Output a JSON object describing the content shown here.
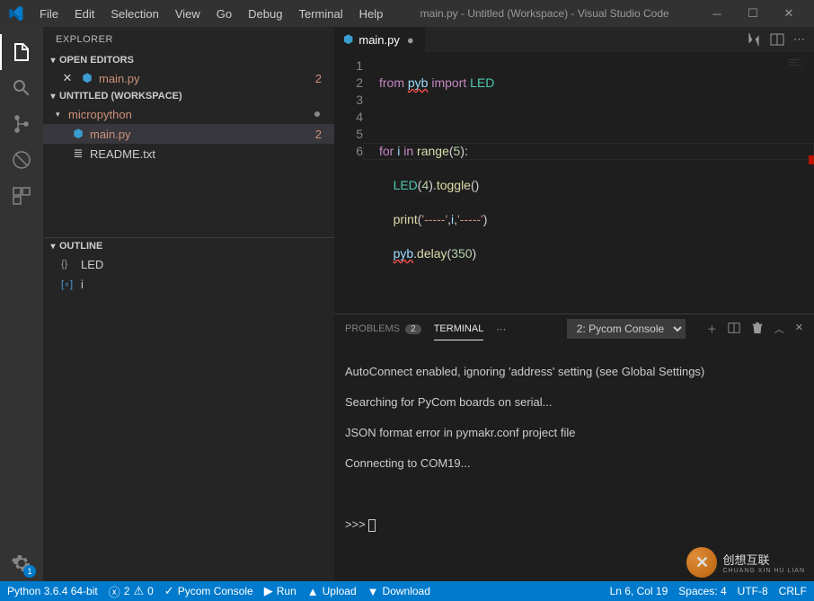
{
  "menu": [
    "File",
    "Edit",
    "Selection",
    "View",
    "Go",
    "Debug",
    "Terminal",
    "Help"
  ],
  "window_title": "main.py - Untitled (Workspace) - Visual Studio Code",
  "sidebar": {
    "title": "EXPLORER",
    "sections": {
      "open_editors": {
        "label": "OPEN EDITORS",
        "items": [
          {
            "name": "main.py",
            "dirty": true,
            "badge": "2"
          }
        ]
      },
      "workspace": {
        "label": "UNTITLED (WORKSPACE)",
        "folder": {
          "name": "micropython",
          "modified": true
        },
        "files": [
          {
            "name": "main.py",
            "badge": "2",
            "modified": true
          },
          {
            "name": "README.txt"
          }
        ]
      },
      "outline": {
        "label": "OUTLINE",
        "items": [
          {
            "sym": "{}",
            "name": "LED"
          },
          {
            "sym": "[∘]",
            "name": "i"
          }
        ]
      }
    }
  },
  "editor": {
    "tab": {
      "name": "main.py"
    },
    "lines": [
      "1",
      "2",
      "3",
      "4",
      "5",
      "6"
    ],
    "code": {
      "l1_from": "from",
      "l1_pyb": "pyb",
      "l1_import": "import",
      "l1_led": "LED",
      "l3_for": "for",
      "l3_i": "i",
      "l3_in": "in",
      "l3_range": "range",
      "l3_n": "5",
      "l4_led": "LED",
      "l4_n": "4",
      "l4_toggle": "toggle",
      "l5_print": "print",
      "l5_s1": "'-----'",
      "l5_i": "i",
      "l5_s2": "'-----'",
      "l6_pyb": "pyb",
      "l6_delay": "delay",
      "l6_n": "350"
    }
  },
  "panel": {
    "problems": {
      "label": "PROBLEMS",
      "count": "2"
    },
    "terminal_label": "TERMINAL",
    "select_value": "2: Pycom Console",
    "lines": [
      "AutoConnect enabled, ignoring 'address' setting (see Global Settings)",
      "Searching for PyCom boards on serial...",
      "JSON format error in pymakr.conf project file",
      "Connecting to COM19..."
    ],
    "prompt": ">>> "
  },
  "statusbar": {
    "python": "Python 3.6.4 64-bit",
    "errors": "2",
    "warnings": "0",
    "console": "Pycom Console",
    "run": "Run",
    "upload": "Upload",
    "download": "Download",
    "ln_col": "Ln 6, Col 19",
    "spaces": "Spaces: 4",
    "encoding": "UTF-8",
    "eol": "CRLF"
  },
  "gear_badge": "1",
  "watermark": {
    "main": "创想互联",
    "sub": "CHUANG XIN HU LIAN"
  }
}
